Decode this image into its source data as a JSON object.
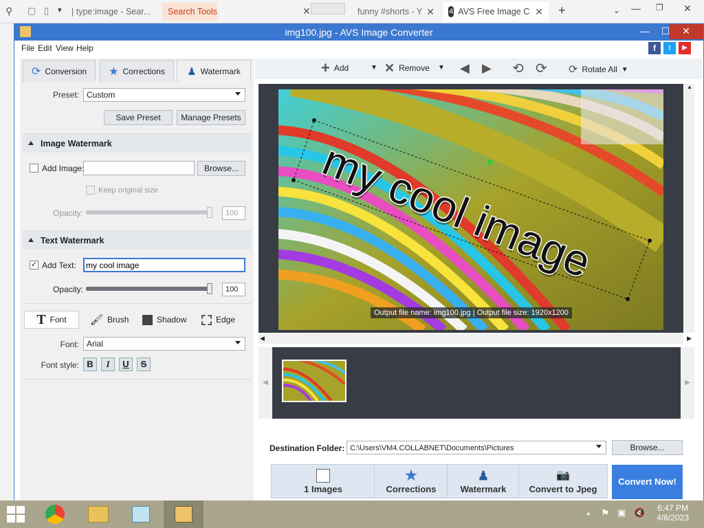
{
  "browser": {
    "tabs": [
      {
        "label": "| type:image - Sear...",
        "active": false
      },
      {
        "label": "Search Tools",
        "active": false
      },
      {
        "label": "funny #shorts - Y",
        "active": false
      },
      {
        "label": "AVS Free Image C",
        "active": true,
        "badge": "4"
      }
    ],
    "new_tab_label": "+"
  },
  "app": {
    "title": "img100.jpg - AVS Image Converter",
    "menu": [
      "File",
      "Edit",
      "View",
      "Help"
    ],
    "tabs": [
      {
        "label": "Conversion",
        "icon": "refresh-icon"
      },
      {
        "label": "Corrections",
        "icon": "star-icon"
      },
      {
        "label": "Watermark",
        "icon": "stamp-icon",
        "active": true
      }
    ],
    "preset": {
      "label": "Preset:",
      "value": "Custom"
    },
    "buttons": {
      "save_preset": "Save Preset",
      "manage_presets": "Manage Presets"
    },
    "image_watermark": {
      "heading": "Image Watermark",
      "add_image_label": "Add Image:",
      "add_image_value": "",
      "browse": "Browse...",
      "keep_original": "Keep original size",
      "opacity_label": "Opacity:",
      "opacity_value": "100"
    },
    "text_watermark": {
      "heading": "Text Watermark",
      "add_text_label": "Add Text:",
      "add_text_value": "my cool image",
      "opacity_label": "Opacity:",
      "opacity_value": "100"
    },
    "subtabs": [
      "Font",
      "Brush",
      "Shadow",
      "Edge"
    ],
    "font": {
      "label": "Font:",
      "value": "Arial"
    },
    "font_style": {
      "label": "Font style:",
      "buttons": [
        "B",
        "I",
        "U",
        "S"
      ]
    },
    "toolbar": {
      "add": "Add",
      "remove": "Remove",
      "rotate_all": "Rotate All"
    },
    "preview": {
      "watermark_text": "my cool image",
      "output_info": "Output file name: img100.jpg | Output file size: 1920x1200"
    },
    "destination": {
      "label": "Destination Folder:",
      "value": "C:\\Users\\VM4.COLLABNET\\Documents\\Pictures",
      "browse": "Browse..."
    },
    "steps": [
      {
        "label": "1 Images"
      },
      {
        "label": "Corrections"
      },
      {
        "label": "Watermark"
      },
      {
        "label": "Convert to Jpeg"
      }
    ],
    "convert_button": "Convert Now!",
    "colors": {
      "accent": "#3b78d1",
      "convert": "#3a7fe0"
    }
  },
  "taskbar": {
    "time": "6:47 PM",
    "date": "4/8/2023"
  }
}
